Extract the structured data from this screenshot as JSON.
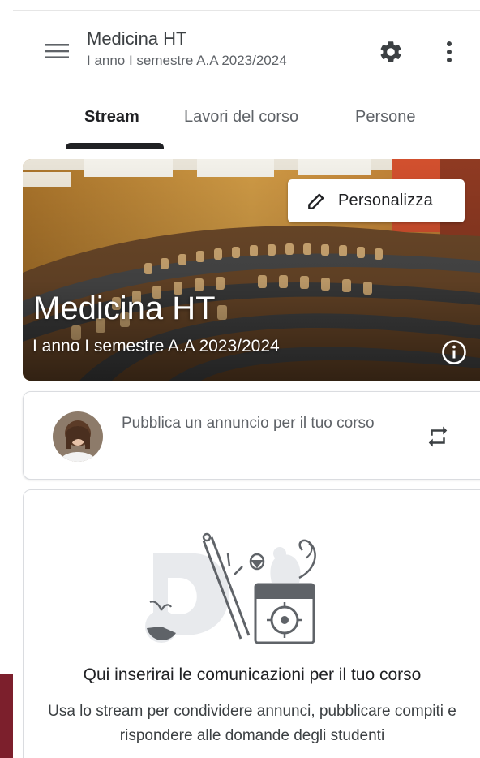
{
  "header": {
    "course_title": "Medicina HT",
    "course_subtitle": "I anno I semestre A.A 2023/2024",
    "menu_icon": "hamburger-menu-icon",
    "settings_icon": "gear-icon",
    "more_icon": "more-vert-icon"
  },
  "tabs": [
    {
      "label": "Stream",
      "active": true
    },
    {
      "label": "Lavori del corso",
      "active": false
    },
    {
      "label": "Persone",
      "active": false
    }
  ],
  "banner": {
    "title": "Medicina HT",
    "subtitle": "I anno I semestre A.A 2023/2024",
    "customize_label": "Personalizza",
    "customize_icon": "pencil-icon",
    "info_icon": "info-icon"
  },
  "announcement": {
    "placeholder": "Pubblica un annuncio per il tuo corso",
    "repost_icon": "repost-icon"
  },
  "empty_state": {
    "title": "Qui inserirai le comunicazioni per il tuo corso",
    "description": "Usa lo stream per condividere annunci, pubblicare compiti e rispondere alle domande degli studenti"
  },
  "colors": {
    "accent": "#202124",
    "side_accent": "#7c1f2c",
    "divider": "#dadce0"
  }
}
